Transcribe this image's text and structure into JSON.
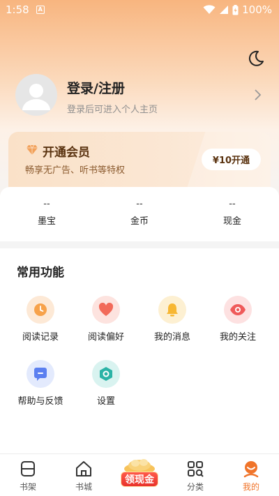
{
  "status_bar": {
    "time": "1:58",
    "app_badge": "A",
    "battery_text": "100%"
  },
  "profile": {
    "title": "登录/注册",
    "subtitle": "登录后可进入个人主页"
  },
  "vip": {
    "title": "开通会员",
    "subtitle": "畅享无广告、听书等特权",
    "button": "¥10开通"
  },
  "stats": [
    {
      "value": "--",
      "label": "墨宝"
    },
    {
      "value": "--",
      "label": "金币"
    },
    {
      "value": "--",
      "label": "现金"
    }
  ],
  "functions": {
    "title": "常用功能",
    "items": [
      {
        "label": "阅读记录",
        "icon": "clock-icon",
        "color": "#f7a24a",
        "bg": "#fde9d6"
      },
      {
        "label": "阅读偏好",
        "icon": "heart-icon",
        "color": "#f26a5a",
        "bg": "#fde3df"
      },
      {
        "label": "我的消息",
        "icon": "bell-icon",
        "color": "#f7b733",
        "bg": "#fdf0d2"
      },
      {
        "label": "我的关注",
        "icon": "eye-icon",
        "color": "#ef5a5a",
        "bg": "#fde1e1"
      },
      {
        "label": "帮助与反馈",
        "icon": "feedback-icon",
        "color": "#5b7ff0",
        "bg": "#e3eafd"
      },
      {
        "label": "设置",
        "icon": "settings-icon",
        "color": "#2bb3a6",
        "bg": "#d9f3f0"
      }
    ]
  },
  "tabbar": {
    "tabs": [
      {
        "label": "书架",
        "icon": "bookshelf-icon",
        "active": false
      },
      {
        "label": "书城",
        "icon": "home-icon",
        "active": false
      },
      {
        "label": "分类",
        "icon": "category-icon",
        "active": false
      },
      {
        "label": "我的",
        "icon": "mine-icon",
        "active": true
      }
    ],
    "promo_label": "领现金"
  },
  "colors": {
    "accent": "#f0742a",
    "vip_text": "#5a3310"
  }
}
